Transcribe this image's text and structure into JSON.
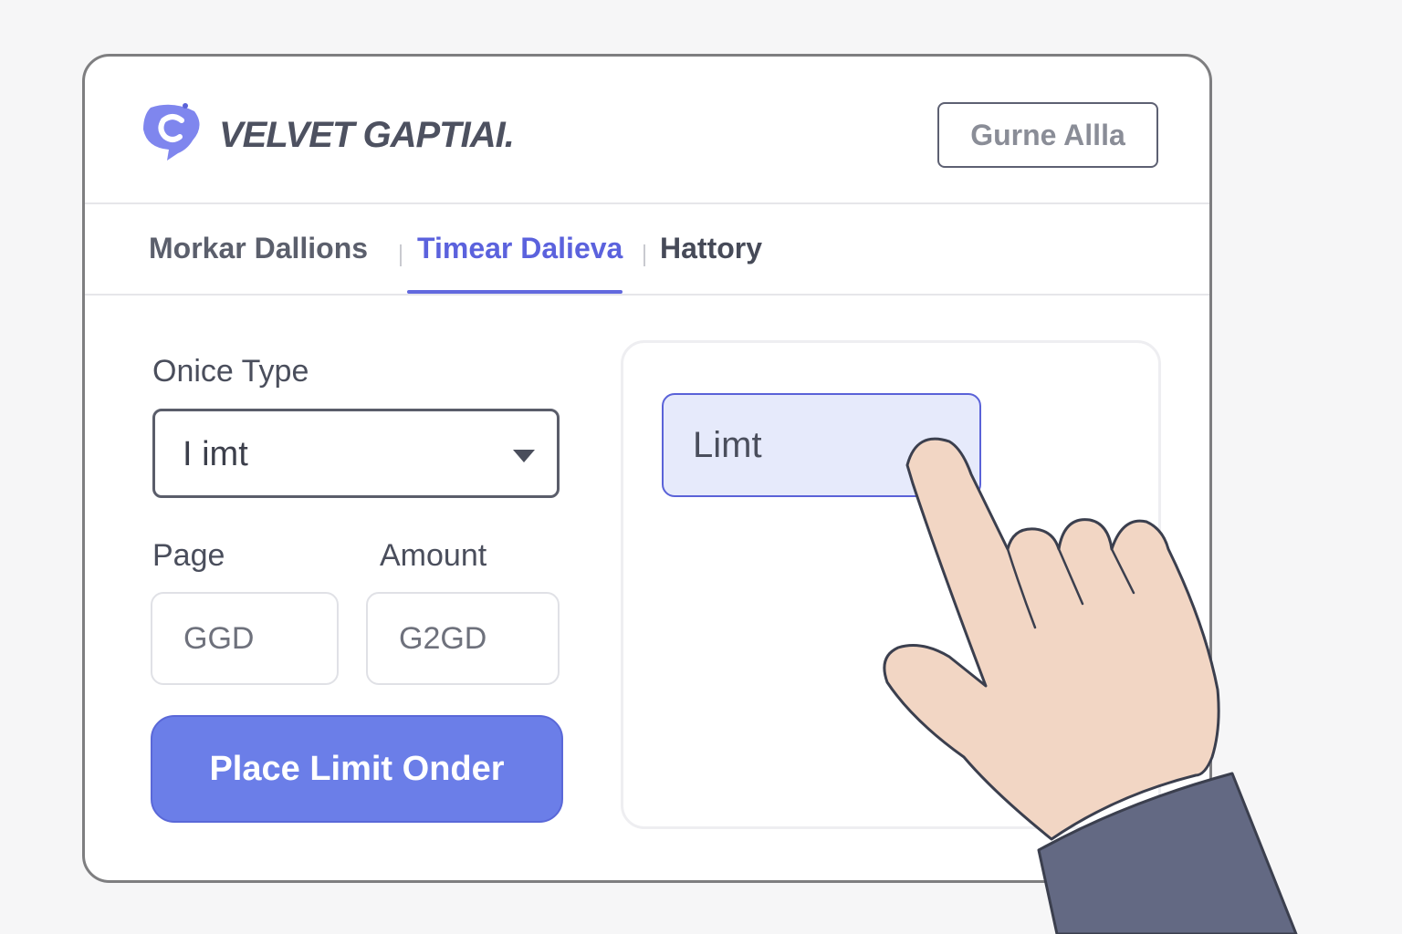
{
  "header": {
    "brand": "VELVET GAPTIAI.",
    "action_button": "Gurne Allla"
  },
  "tabs": [
    {
      "label": "Morkar Dallions",
      "active": false
    },
    {
      "label": "Timear Dalieva",
      "active": true
    },
    {
      "label": "Hattory",
      "active": false
    }
  ],
  "form": {
    "order_type_label": "Onice Type",
    "order_type_value": "I imt",
    "price_label": "Page",
    "price_value": "GGD",
    "amount_label": "Amount",
    "amount_value": "G2GD",
    "submit_label": "Place Limit Onder"
  },
  "panel": {
    "option_label": "Limt"
  },
  "colors": {
    "accent": "#6b7ee8",
    "tab_active": "#5b62dd",
    "chip_bg": "#e6eafb"
  },
  "icons": [
    "brand-logo-icon",
    "chevron-down-icon",
    "pointing-hand-icon"
  ]
}
